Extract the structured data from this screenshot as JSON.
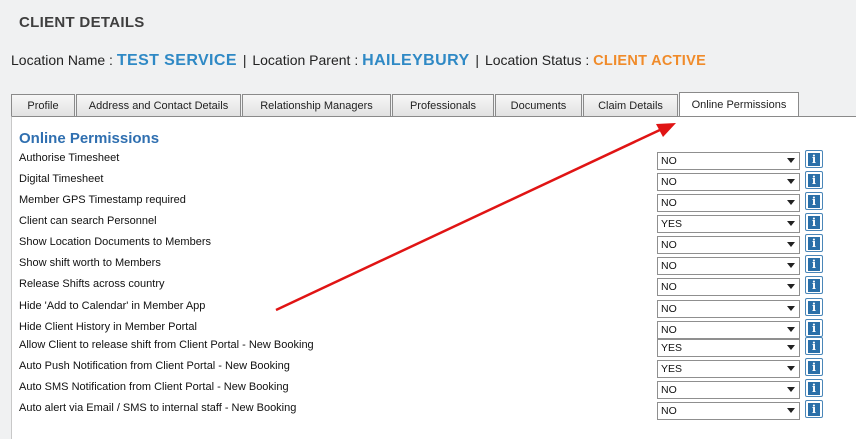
{
  "page": {
    "title": "CLIENT DETAILS"
  },
  "location": {
    "name_label": "Location Name :",
    "name_value": "TEST SERVICE",
    "parent_label": "Location Parent :",
    "parent_value": "HAILEYBURY",
    "status_label": "Location Status :",
    "status_value": "CLIENT ACTIVE",
    "separator": "|"
  },
  "tabs": [
    {
      "label": "Profile"
    },
    {
      "label": "Address and Contact Details"
    },
    {
      "label": "Relationship Managers"
    },
    {
      "label": "Professionals"
    },
    {
      "label": "Documents"
    },
    {
      "label": "Claim Details"
    },
    {
      "label": "Online Permissions",
      "active": true
    }
  ],
  "permissions": {
    "title": "Online Permissions",
    "rows": [
      {
        "label": "Authorise Timesheet",
        "value": "NO"
      },
      {
        "label": "Digital Timesheet",
        "value": "NO"
      },
      {
        "label": "Member GPS Timestamp required",
        "value": "NO"
      },
      {
        "label": "Client can search Personnel",
        "value": "YES"
      },
      {
        "label": "Show Location Documents to Members",
        "value": "NO"
      },
      {
        "label": "Show shift worth to Members",
        "value": "NO"
      },
      {
        "label": "Release Shifts across country",
        "value": "NO"
      },
      {
        "label": "Hide 'Add to Calendar' in Member App",
        "value": "NO"
      },
      {
        "label": "Hide Client History in Member Portal",
        "value": "NO"
      },
      {
        "label": "Allow Client to release shift from Client Portal - New Booking",
        "value": "YES"
      },
      {
        "label": "Auto Push Notification from Client Portal - New Booking",
        "value": "YES"
      },
      {
        "label": "Auto SMS Notification from Client Portal - New Booking",
        "value": "NO"
      },
      {
        "label": "Auto alert via Email / SMS to internal staff - New Booking",
        "value": "NO"
      }
    ]
  },
  "icons": {
    "info": "info-icon",
    "dropdown": "chevron-down-icon",
    "annotation": "red-arrow-annotation"
  },
  "colors": {
    "accent_blue": "#2f89c5",
    "status_orange": "#f08b2a",
    "section_title": "#2f6fb0",
    "arrow_red": "#e01414"
  }
}
